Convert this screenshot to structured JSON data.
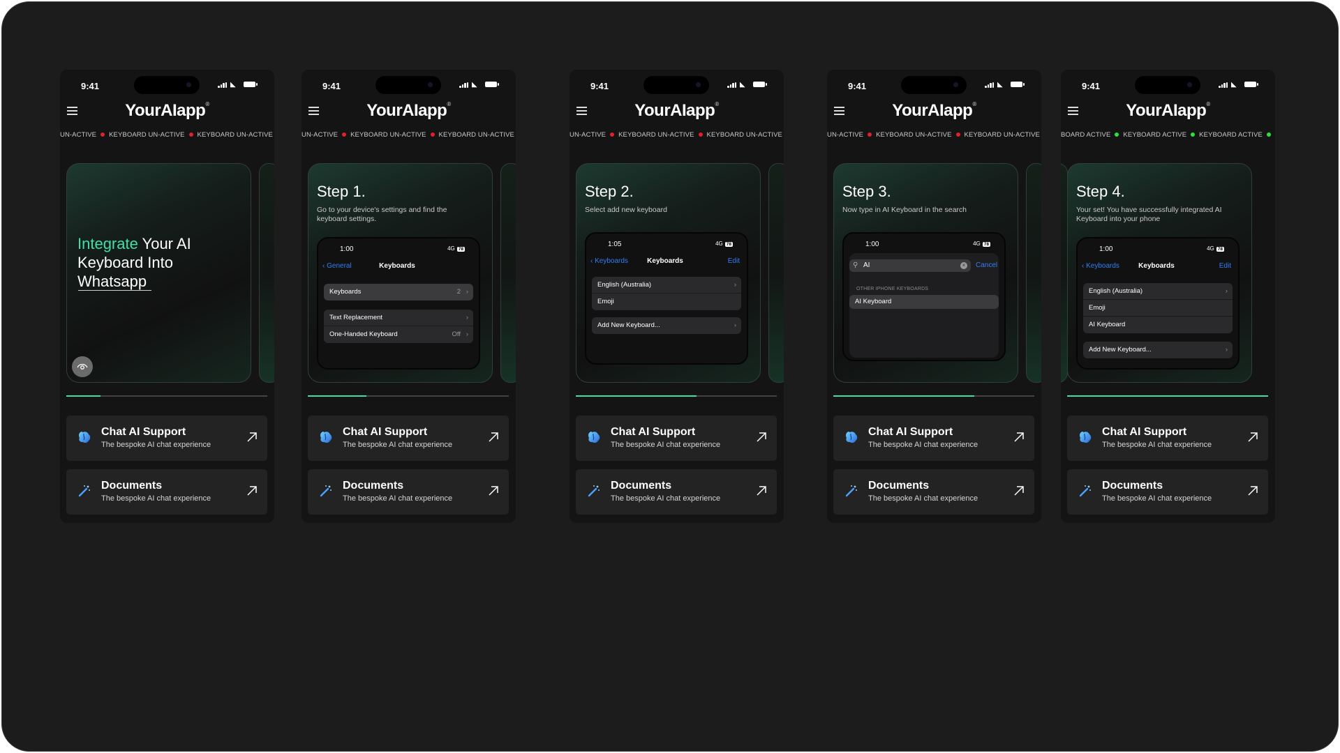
{
  "accent_color": "#3ee0a8",
  "status_time": "9:41",
  "logo": {
    "text": "YourAIapp",
    "mark": "®"
  },
  "inactive_label": "KEYBOARD UN-ACTIVE",
  "inactive_label_partial": "UN-ACTIVE",
  "active_label": "KEYBOARD ACTIVE",
  "active_label_partial": "BOARD ACTIVE",
  "intro": {
    "highlight": "Integrate",
    "line1_rest": " Your AI",
    "line2": "Keyboard Into",
    "line3": "Whatsapp"
  },
  "steps": [
    {
      "title": "Step 1.",
      "desc": "Go to your device's settings and find the keyboard settings."
    },
    {
      "title": "Step 2.",
      "desc": "Select add new keyboard"
    },
    {
      "title": "Step 3.",
      "desc": "Now type in AI Keyboard in the search"
    },
    {
      "title": "Step 4.",
      "desc": "Your set! You have successfully integrated AI Keyboard into your phone"
    }
  ],
  "shots": {
    "s1": {
      "time": "1:00",
      "back": "General",
      "title": "Keyboards",
      "rows_a": [
        {
          "label": "Keyboards",
          "value": "2"
        }
      ],
      "rows_b": [
        {
          "label": "Text Replacement",
          "value": ""
        },
        {
          "label": "One-Handed Keyboard",
          "value": "Off"
        }
      ]
    },
    "s2": {
      "time": "1:05",
      "back": "Keyboards",
      "title": "Keyboards",
      "edit": "Edit",
      "rows_a": [
        "English (Australia)",
        "Emoji"
      ],
      "add": "Add New Keyboard..."
    },
    "s3": {
      "time": "1:00",
      "search_value": "AI",
      "cancel": "Cancel",
      "section": "OTHER IPHONE KEYBOARDS",
      "result": "AI Keyboard"
    },
    "s4": {
      "time": "1:00",
      "back": "Keyboards",
      "title": "Keyboards",
      "edit": "Edit",
      "rows_a": [
        "English (Australia)",
        "Emoji",
        "AI Keyboard"
      ],
      "add": "Add New Keyboard..."
    },
    "network": "4G",
    "battery": "78"
  },
  "progress": [
    0.17,
    0.29,
    0.6,
    0.7,
    1.0
  ],
  "features": [
    {
      "title": "Chat AI Support",
      "subtitle": "The bespoke AI chat experience",
      "icon": "brain-icon"
    },
    {
      "title": "Documents",
      "subtitle": "The bespoke AI chat experience",
      "icon": "magic-wand-icon"
    }
  ]
}
